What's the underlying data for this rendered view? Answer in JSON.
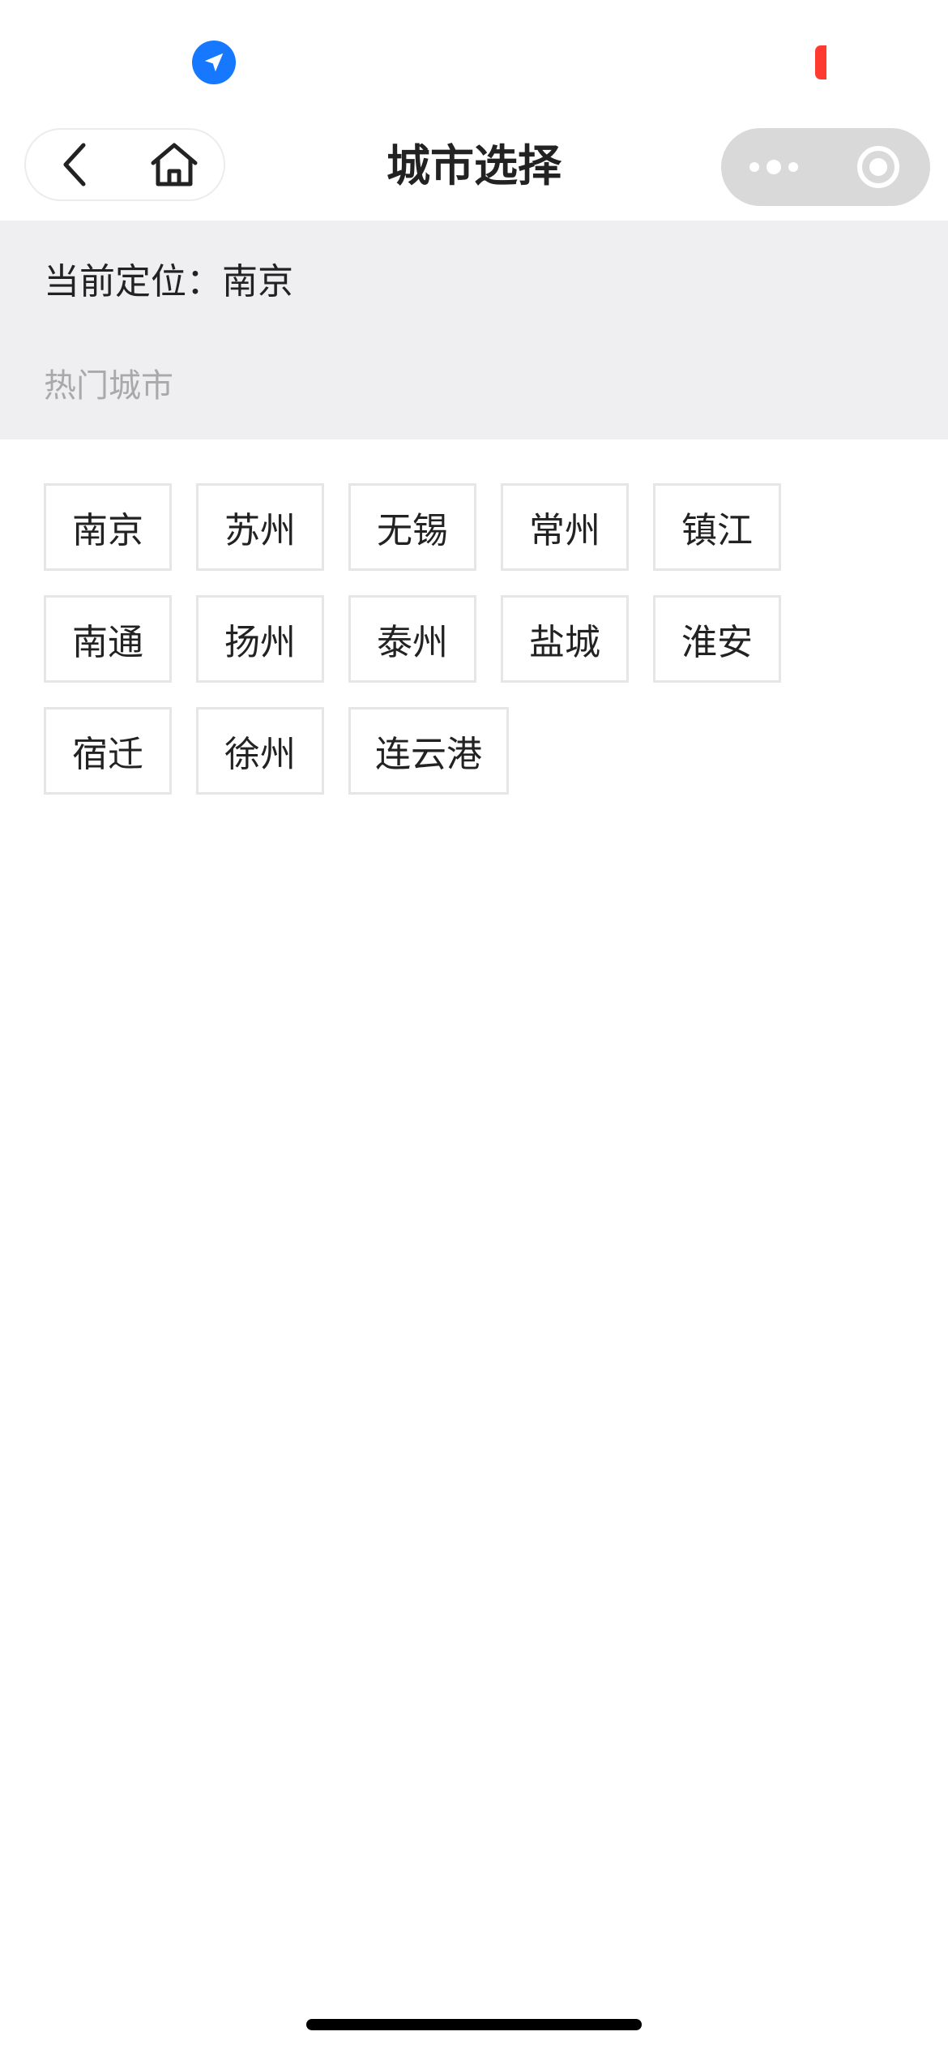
{
  "nav": {
    "title": "城市选择"
  },
  "location": {
    "label": "当前定位：南京"
  },
  "hot": {
    "label": "热门城市",
    "cities": [
      "南京",
      "苏州",
      "无锡",
      "常州",
      "镇江",
      "南通",
      "扬州",
      "泰州",
      "盐城",
      "淮安",
      "宿迁",
      "徐州",
      "连云港"
    ]
  },
  "colors": {
    "accent_blue": "#1677ff",
    "battery_red": "#ff3b30",
    "section_gray": "#efeef1",
    "muted_text": "#a9a9ac"
  },
  "icons": {
    "status_location": "location-arrow-icon",
    "back": "chevron-left-icon",
    "home": "home-icon",
    "more": "more-dots-icon",
    "close": "circle-target-icon"
  }
}
